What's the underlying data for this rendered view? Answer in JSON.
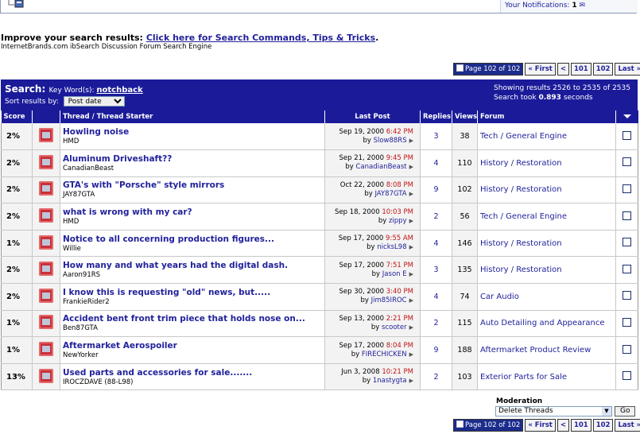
{
  "notifications": {
    "label": "Your Notifications:",
    "count": "1"
  },
  "search_tip": {
    "prefix": "Improve your search results:",
    "link": "Click here for Search Commands, Tips & Tricks",
    "suffix": ".",
    "subline": "InternetBrands.com ibSearch Discussion Forum Search Engine"
  },
  "pager": {
    "current": "Page 102 of 102",
    "first": "« First",
    "prev": "<",
    "p101": "101",
    "p102": "102",
    "last": "Last »"
  },
  "search_header": {
    "title": "Search:",
    "keyword_label": "Key Word(s):",
    "keyword": "notchback",
    "sort_label": "Sort results by:",
    "sort_value": "Post date",
    "showing": "Showing results 2526 to 2535 of 2535",
    "took_prefix": "Search took",
    "took_value": "0.893",
    "took_suffix": "seconds"
  },
  "columns": {
    "score": "Score",
    "thread": "Thread / Thread Starter",
    "last_post": "Last Post",
    "replies": "Replies",
    "views": "Views",
    "forum": "Forum"
  },
  "rows": [
    {
      "score": "2%",
      "title": "Howling noise",
      "starter": "HMD",
      "date": "Sep 19, 2000",
      "time": "6:42 PM",
      "by": "Slow88RS",
      "replies": "3",
      "views": "38",
      "forum": "Tech / General Engine"
    },
    {
      "score": "2%",
      "title": "Aluminum Driveshaft??",
      "starter": "CanadianBeast",
      "date": "Sep 21, 2000",
      "time": "9:45 PM",
      "by": "CanadianBeast",
      "replies": "4",
      "views": "110",
      "forum": "History / Restoration"
    },
    {
      "score": "2%",
      "title": "GTA's with \"Porsche\" style mirrors",
      "starter": "JAY87GTA",
      "date": "Oct 22, 2000",
      "time": "8:08 PM",
      "by": "JAY87GTA",
      "replies": "9",
      "views": "102",
      "forum": "History / Restoration"
    },
    {
      "score": "2%",
      "title": "what is wrong with my car?",
      "starter": "HMD",
      "date": "Sep 18, 2000",
      "time": "10:03 PM",
      "by": "zippy",
      "replies": "2",
      "views": "56",
      "forum": "Tech / General Engine"
    },
    {
      "score": "1%",
      "title": "Notice to all concerning production figures...",
      "starter": "Willie",
      "date": "Sep 17, 2000",
      "time": "9:55 AM",
      "by": "nicksL98",
      "replies": "4",
      "views": "146",
      "forum": "History / Restoration"
    },
    {
      "score": "2%",
      "title": "How many and what years had the digital dash.",
      "starter": "Aaron91RS",
      "date": "Sep 17, 2000",
      "time": "7:51 PM",
      "by": "Jason E",
      "replies": "3",
      "views": "135",
      "forum": "History / Restoration"
    },
    {
      "score": "2%",
      "title": "I know this is requesting \"old\" news, but.....",
      "starter": "FrankieRider2",
      "date": "Sep 30, 2000",
      "time": "3:40 PM",
      "by": "Jim85IROC",
      "replies": "4",
      "views": "74",
      "forum": "Car Audio"
    },
    {
      "score": "1%",
      "title": "Accident bent front trim piece that holds nose on...",
      "starter": "Ben87GTA",
      "date": "Sep 13, 2000",
      "time": "2:21 PM",
      "by": "scooter",
      "replies": "2",
      "views": "115",
      "forum": "Auto Detailing and Appearance"
    },
    {
      "score": "1%",
      "title": "Aftermarket Aerospoiler",
      "starter": "NewYorker",
      "date": "Sep 17, 2000",
      "time": "8:04 PM",
      "by": "FIRECHICKEN",
      "replies": "9",
      "views": "188",
      "forum": "Aftermarket Product Review"
    },
    {
      "score": "13%",
      "title": "Used parts and accessories for sale.......",
      "starter": "IROCZDAVE (88-L98)",
      "date": "Jun 3, 2008",
      "time": "10:21 PM",
      "by": "1nastygta",
      "replies": "2",
      "views": "103",
      "forum": "Exterior Parts for Sale"
    }
  ],
  "moderation": {
    "label": "Moderation",
    "select_value": "Delete Threads",
    "go": "Go"
  }
}
